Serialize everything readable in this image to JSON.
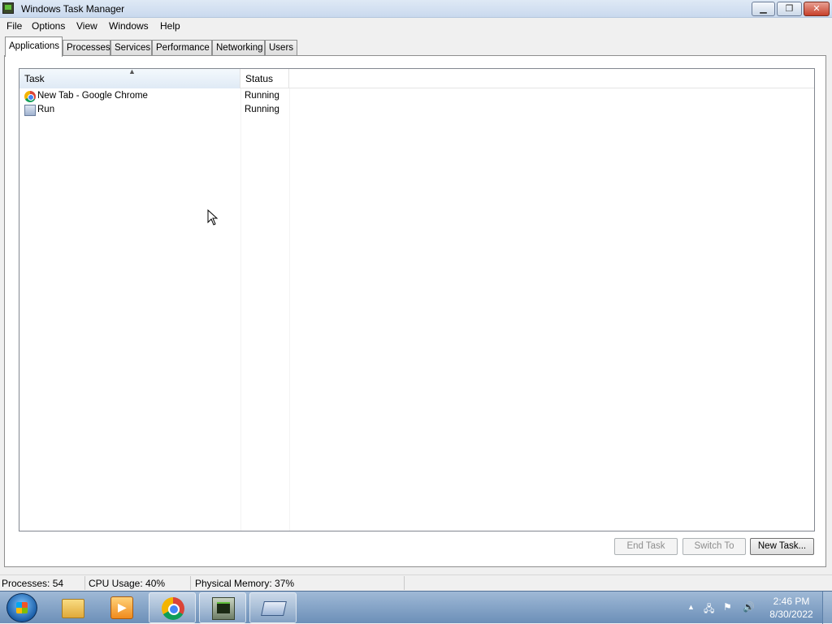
{
  "window": {
    "title": "Windows Task Manager",
    "minimize_glyph": "▁",
    "maximize_glyph": "❐",
    "close_glyph": "✕"
  },
  "menu": [
    "File",
    "Options",
    "View",
    "Windows",
    "Help"
  ],
  "tabs": [
    {
      "label": "Applications",
      "active": true
    },
    {
      "label": "Processes",
      "active": false
    },
    {
      "label": "Services",
      "active": false
    },
    {
      "label": "Performance",
      "active": false
    },
    {
      "label": "Networking",
      "active": false
    },
    {
      "label": "Users",
      "active": false
    }
  ],
  "applications": {
    "columns": [
      "Task",
      "Status"
    ],
    "rows": [
      {
        "task": "New Tab - Google Chrome",
        "status": "Running",
        "icon": "chrome-icon"
      },
      {
        "task": "Run",
        "status": "Running",
        "icon": "run-icon"
      }
    ]
  },
  "buttons": {
    "end_task": "End Task",
    "switch_to": "Switch To",
    "new_task": "New Task..."
  },
  "statusbar": {
    "processes": "Processes: 54",
    "cpu": "CPU Usage: 40%",
    "memory": "Physical Memory: 37%"
  },
  "taskbar": {
    "pinned": [
      "start-icon",
      "explorer-icon",
      "media-player-icon",
      "chrome-icon",
      "task-manager-icon",
      "run-icon"
    ],
    "clock_time": "2:46 PM",
    "clock_date": "8/30/2022",
    "tray_icons": [
      "show-hidden-icons-icon",
      "network-icon",
      "action-center-icon",
      "volume-icon"
    ]
  },
  "colors": {
    "accent": "#1a5ea8",
    "taskbar": "#6c8fb8",
    "disabled_text": "#8d8d8d"
  }
}
